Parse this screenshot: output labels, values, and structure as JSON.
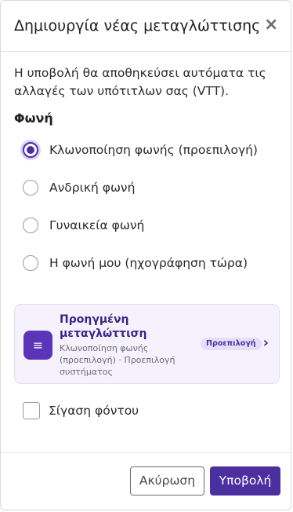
{
  "dialog": {
    "title": "Δημιουργία νέας μεταγλώττισης",
    "close_symbol": "×",
    "description": "Η υποβολή θα αποθηκεύσει αυτόματα τις αλλαγές των υπότιτλων σας (VTT).",
    "voice_section_label": "Φωνή",
    "voice_options": [
      {
        "label": "Κλωνοποίηση φωνής (προεπιλογή)",
        "selected": true
      },
      {
        "label": "Ανδρική φωνή",
        "selected": false
      },
      {
        "label": "Γυναικεία φωνή",
        "selected": false
      },
      {
        "label": "Η φωνή μου (ηχογράφηση τώρα)",
        "selected": false
      }
    ],
    "advanced_card": {
      "icon": "list-icon",
      "icon_glyph": "≡",
      "title": "Προηγμένη μεταγλώττιση",
      "subtitle": "Κλωνοποίηση φωνής (προεπιλογή) · Προεπιλογή συστήματος",
      "badge": "Προεπιλογή",
      "chevron": "›"
    },
    "background_checkbox": {
      "label": "Σίγαση φόντου",
      "checked": false
    },
    "buttons": {
      "cancel": "Ακύρωση",
      "submit": "Υποβολή"
    }
  },
  "colors": {
    "accent": "#4c2f9e",
    "card_background": "#f5f2fd",
    "badge_background": "#e6def9"
  }
}
